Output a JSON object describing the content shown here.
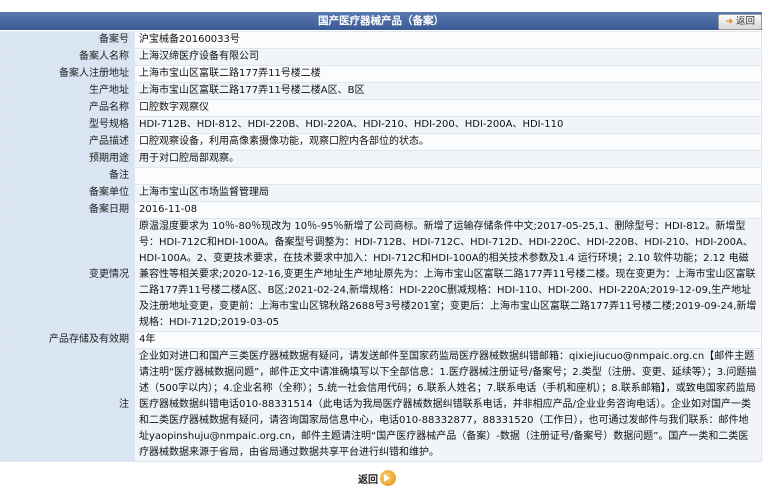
{
  "header": {
    "title": "国产医疗器械产品（备案）",
    "back_label": "返回"
  },
  "rows": [
    {
      "label": "备案号",
      "value": "沪宝械备20160033号"
    },
    {
      "label": "备案人名称",
      "value": "上海汉缔医疗设备有限公司"
    },
    {
      "label": "备案人注册地址",
      "value": "上海市宝山区富联二路177弄11号楼二楼"
    },
    {
      "label": "生产地址",
      "value": "上海市宝山区富联二路177弄11号楼二楼A区、B区"
    },
    {
      "label": "产品名称",
      "value": "口腔数字观察仪"
    },
    {
      "label": "型号规格",
      "value": "HDI-712B、HDI-812、HDI-220B、HDI-220A、HDI-210、HDI-200、HDI-200A、HDI-110"
    },
    {
      "label": "产品描述",
      "value": "口腔观察设备，利用高像素摄像功能，观察口腔内各部位的状态。"
    },
    {
      "label": "预期用途",
      "value": "用于对口腔局部观察。"
    },
    {
      "label": "备注",
      "value": ""
    },
    {
      "label": "备案单位",
      "value": "上海市宝山区市场监督管理局"
    },
    {
      "label": "备案日期",
      "value": "2016-11-08"
    },
    {
      "label": "变更情况",
      "value": "原温湿度要求为 10％-80％现改为 10％-95％新增了公司商标。新增了运输存储条件中文;2017-05-25,1、删除型号：HDI-812。新增型号：HDI-712C和HDI-100A。备案型号调整为：HDI-712B、HDI-712C、HDI-712D、HDI-220C、HDI-220B、HDI-210、HDI-200A、HDI-100A。2、变更技术要求，在技术要求中加入：HDI-712C和HDI-100A的相关技术参数及1.4 运行环境；2.10 软件功能；2.12 电磁兼容性等相关要求;2020-12-16,变更生产地址生产地址原先为：上海市宝山区富联二路177弄11号楼二楼。现在变更为：上海市宝山区富联二路177弄11号楼二楼A区、B区;2021-02-24,新增规格：HDI-220C删减规格：HDI-110、HDI-200、HDI-220A;2019-12-09,生产地址及注册地址变更，变更前：上海市宝山区锦秋路2688号3号楼201室；变更后：上海市宝山区富联二路177弄11号楼二楼;2019-09-24,新增规格：HDI-712D;2019-03-05"
    },
    {
      "label": "产品存储及有效期",
      "value": "4年"
    },
    {
      "label": "注",
      "value": "企业如对进口和国产三类医疗器械数据有疑问，请发送邮件至国家药监局医疗器械数据纠错邮箱：qixiejiucuo@nmpaic.org.cn【邮件主题请注明“医疗器械数据问题”，邮件正文中请准确填写以下全部信息：1.医疗器械注册证号/备案号；2.类型（注册、变更、延续等）；3.问题描述（500字以内）；4.企业名称（全称）；5.统一社会信用代码；6.联系人姓名；7.联系电话（手机和座机）；8.联系邮箱】，或致电国家药监局医疗器械数据纠错电话010-88331514（此电话为我局医疗器械数据纠错联系电话，并非相应产品/企业业务咨询电话）。企业如对国产一类和二类医疗器械数据有疑问，请咨询国家局信息中心，电话010-88332877，88331520（工作日），也可通过发邮件与我们联系：邮件地址yaopinshuju@nmpaic.org.cn，邮件主题请注明“国产医疗器械产品（备案）-数据（注册证号/备案号）数据问题”。国产一类和二类医疗器械数据来源于省局，由省局通过数据共享平台进行纠错和维护。"
    }
  ],
  "footer": {
    "back_label": "返回"
  }
}
